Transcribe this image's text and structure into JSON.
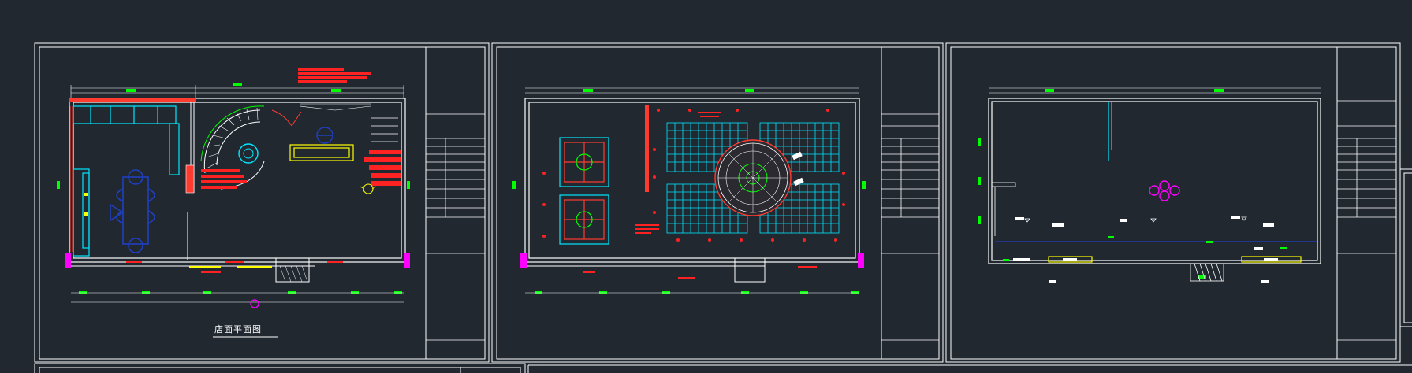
{
  "drawing": {
    "title_text": "店面平面图",
    "background_color": "#212830",
    "line_color_white": "#ffffff",
    "dimension_color": "#00ff00",
    "wall_color": "#ff3b30",
    "ceiling_grid_color": "#00e5ff",
    "furniture_color": "#1f3fbf",
    "accent_magenta": "#ff00ff",
    "accent_yellow": "#ffff00"
  },
  "sheets": [
    {
      "name": "floor-plan-sheet"
    },
    {
      "name": "ceiling-plan-sheet"
    },
    {
      "name": "elevation-sheet"
    }
  ]
}
